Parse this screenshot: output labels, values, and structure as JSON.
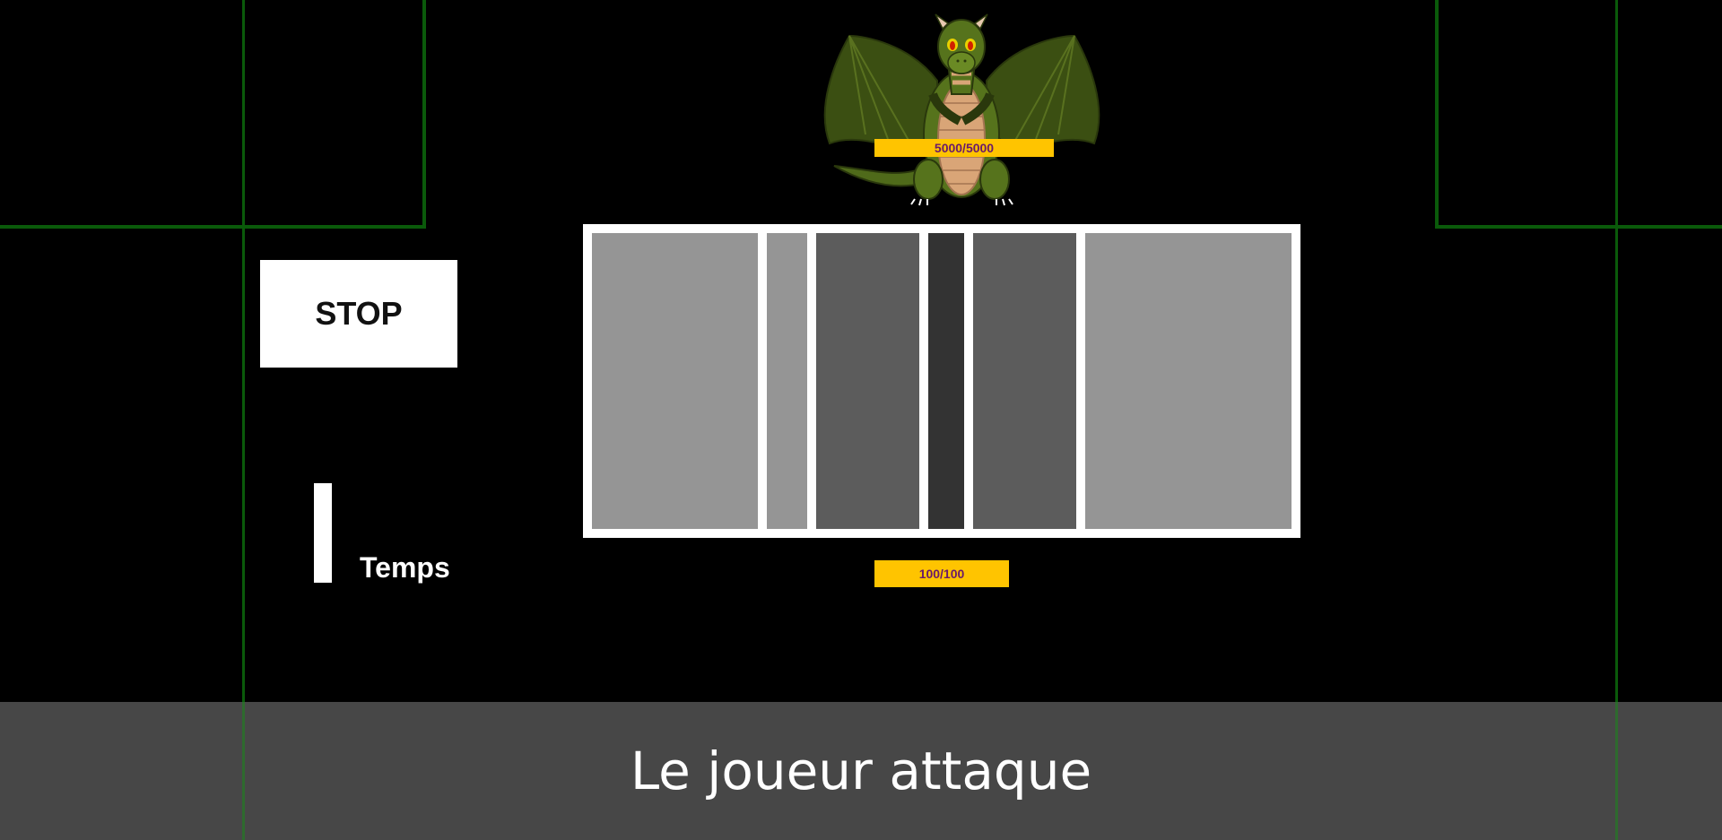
{
  "controls": {
    "stop_label": "STOP",
    "timer_label": "Temps",
    "timer_level": 1.0
  },
  "enemy": {
    "name_icon": "dragon-icon",
    "hp_text": "5000/5000"
  },
  "player": {
    "hp_text": "100/100"
  },
  "gauge": {
    "zones": [
      {
        "shade": "light",
        "color": "#959595"
      },
      {
        "shade": "light",
        "color": "#959595"
      },
      {
        "shade": "medium",
        "color": "#5c5c5c"
      },
      {
        "shade": "dark",
        "color": "#333333"
      },
      {
        "shade": "medium",
        "color": "#5c5c5c"
      },
      {
        "shade": "light",
        "color": "#959595"
      }
    ]
  },
  "status": {
    "message": "Le joueur attaque"
  },
  "colors": {
    "grid_line": "#0a5a0a",
    "hp_bar": "#ffc400",
    "hp_text": "#6a1a6a",
    "banner": "#474747"
  }
}
